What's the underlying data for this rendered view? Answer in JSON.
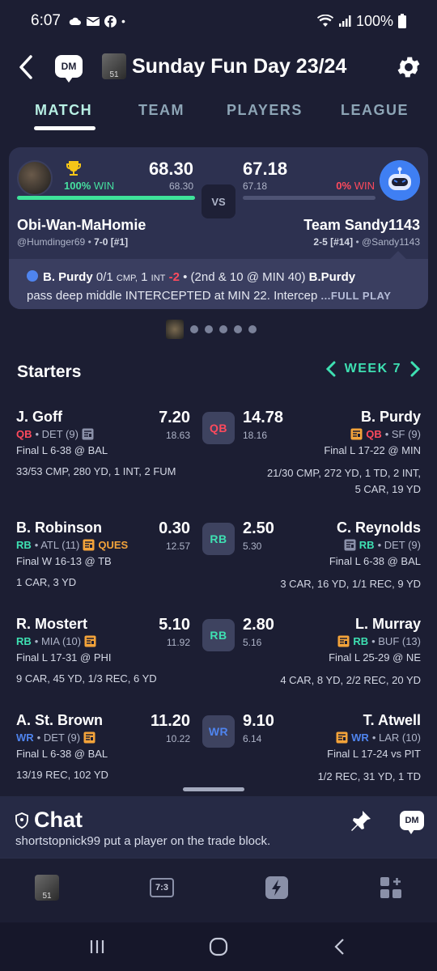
{
  "status_bar": {
    "time": "6:07",
    "dot": "•",
    "battery": "100%"
  },
  "header": {
    "title": "Sunday Fun Day 23/24",
    "dm_label": "DM",
    "league_avatar_text": "51"
  },
  "tabs": [
    "MATCH",
    "TEAM",
    "PLAYERS",
    "LEAGUE"
  ],
  "matchup": {
    "left": {
      "win_pct": "100%",
      "win_label": "WIN",
      "score": "68.30",
      "projected": "68.30",
      "name": "Obi-Wan-MaHomie",
      "handle": "@Humdinger69",
      "record": "7-0 [#1]",
      "win_fraction": 1.0
    },
    "vs": "VS",
    "right": {
      "win_pct": "0%",
      "win_label": "WIN",
      "score": "67.18",
      "projected": "67.18",
      "name": "Team Sandy1143",
      "handle": "@Sandy1143",
      "record": "2-5 [#14]",
      "win_fraction": 0.0
    },
    "play": {
      "player": "B. Purdy",
      "stat": "0/1",
      "stat_unit": "CMP,",
      "stat2": "1",
      "stat2_unit": "INT",
      "delta": "-2",
      "context": "• (2nd & 10 @ MIN 40)",
      "player2": "B.Purdy",
      "desc": "pass deep middle INTERCEPTED at MIN 22. Intercep",
      "full_play": "...FULL PLAY"
    }
  },
  "starters": {
    "title": "Starters",
    "week": "WEEK 7",
    "rows": [
      {
        "pos": "QB",
        "pos_color": "#ff4a5d",
        "left": {
          "name": "J. Goff",
          "pos": "QB",
          "team": "• DET (9)",
          "status": "",
          "pts": "7.20",
          "proj": "18.63",
          "final": "Final L 6-38 @ BAL",
          "stats": "33/53 CMP, 280 YD, 1 INT, 2 FUM"
        },
        "right": {
          "name": "B. Purdy",
          "pos": "QB",
          "team": "• SF (9)",
          "pts": "14.78",
          "proj": "18.16",
          "final": "Final L 17-22 @ MIN",
          "stats1": "21/30 CMP, 272 YD, 1 TD, 2 INT,",
          "stats2": "5 CAR, 19 YD"
        }
      },
      {
        "pos": "RB",
        "pos_color": "#3ee0b2",
        "left": {
          "name": "B. Robinson",
          "pos": "RB",
          "team": "• ATL (11)",
          "status": "QUES",
          "pts": "0.30",
          "proj": "12.57",
          "final": "Final W 16-13 @ TB",
          "stats": "1 CAR, 3 YD"
        },
        "right": {
          "name": "C. Reynolds",
          "pos": "RB",
          "team": "• DET (9)",
          "pts": "2.50",
          "proj": "5.30",
          "final": "Final L 6-38 @ BAL",
          "stats1": "3 CAR, 16 YD, 1/1 REC, 9 YD",
          "stats2": ""
        }
      },
      {
        "pos": "RB",
        "pos_color": "#3ee0b2",
        "left": {
          "name": "R. Mostert",
          "pos": "RB",
          "team": "• MIA (10)",
          "status": "",
          "pts": "5.10",
          "proj": "11.92",
          "final": "Final L 17-31 @ PHI",
          "stats": "9 CAR, 45 YD, 1/3 REC, 6 YD"
        },
        "right": {
          "name": "L. Murray",
          "pos": "RB",
          "team": "• BUF (13)",
          "pts": "2.80",
          "proj": "5.16",
          "final": "Final L 25-29 @ NE",
          "stats1": "4 CAR, 8 YD, 2/2 REC, 20 YD",
          "stats2": ""
        }
      },
      {
        "pos": "WR",
        "pos_color": "#4f84ee",
        "left": {
          "name": "A. St. Brown",
          "pos": "WR",
          "team": "• DET (9)",
          "status": "",
          "pts": "11.20",
          "proj": "10.22",
          "final": "Final L 6-38 @ BAL",
          "stats": "13/19 REC, 102 YD"
        },
        "right": {
          "name": "T. Atwell",
          "pos": "WR",
          "team": "• LAR (10)",
          "pts": "9.10",
          "proj": "6.14",
          "final": "Final L 17-24 vs PIT",
          "stats1": "1/2 REC, 31 YD, 1 TD",
          "stats2": ""
        }
      }
    ]
  },
  "chat": {
    "title": "Chat",
    "message": "shortstopnick99 put a player on the trade block.",
    "dm_label": "DM"
  },
  "bottom_nav": {
    "scores_label": "7:3",
    "league_avatar_text": "51"
  },
  "icons": [
    "cloud-icon",
    "mail-icon",
    "facebook-icon",
    "wifi-icon",
    "signal-icon",
    "battery-icon",
    "back-arrow-icon",
    "gear-icon",
    "trophy-icon",
    "robot-avatar-icon",
    "news-icon",
    "chevron-left-icon",
    "chevron-right-icon",
    "shield-icon",
    "pin-icon",
    "bolt-icon",
    "grid-plus-icon"
  ],
  "colors": {
    "background": "#1c1e33",
    "card": "#2d3150",
    "accent_green": "#3ee0b2",
    "win_green": "#46e0a0",
    "loss_red": "#ff4a5d",
    "news_orange": "#f3a33a",
    "qb_red": "#ff4a5d",
    "rb_teal": "#3ee0b2",
    "wr_blue": "#4f84ee"
  }
}
